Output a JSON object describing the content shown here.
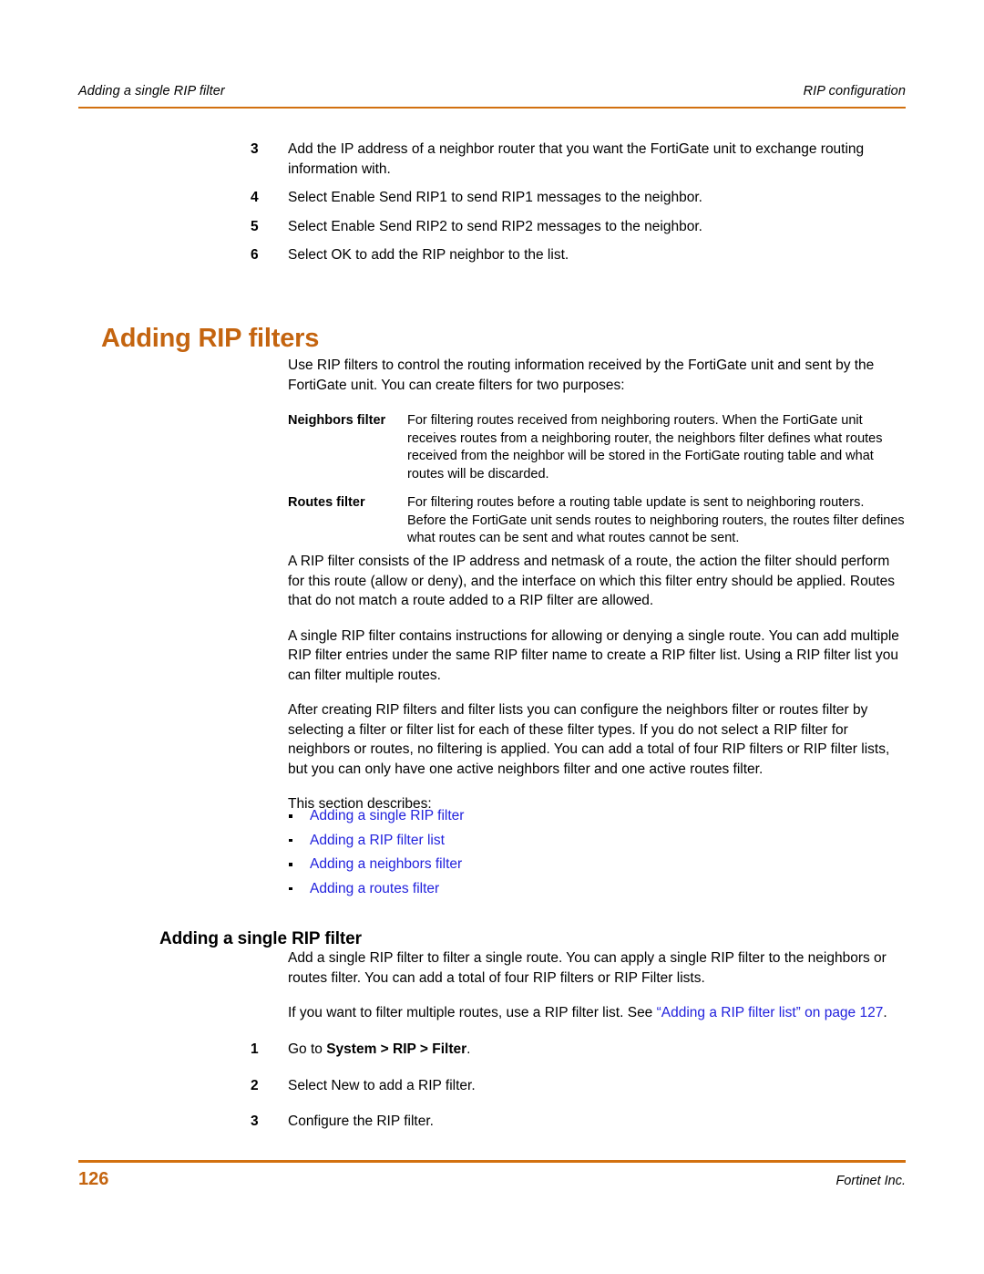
{
  "header": {
    "left_text": "Adding a single RIP filter",
    "right_text": "RIP configuration"
  },
  "top_steps": [
    {
      "number": "3",
      "text": "Add the IP address of a neighbor router that you want the FortiGate unit to exchange routing information with."
    },
    {
      "number": "4",
      "text": "Select Enable Send RIP1 to send RIP1 messages to the neighbor."
    },
    {
      "number": "5",
      "text": "Select Enable Send RIP2 to send RIP2 messages to the neighbor."
    },
    {
      "number": "6",
      "text": "Select OK to add the RIP neighbor to the list."
    }
  ],
  "section": {
    "heading": "Adding RIP filters",
    "intro": "Use RIP filters to control the routing information received by the FortiGate unit and sent by the FortiGate unit. You can create filters for two purposes:",
    "definitions": [
      {
        "term": "Neighbors filter",
        "description": "For filtering routes received from neighboring routers. When the FortiGate unit receives routes from a neighboring router, the neighbors filter defines what routes received from the neighbor will be stored in the FortiGate routing table and what routes will be discarded."
      },
      {
        "term": "Routes filter",
        "description": "For filtering routes before a routing table update is sent to neighboring routers. Before the FortiGate unit sends routes to neighboring routers, the routes filter defines what routes can be sent and what routes cannot be sent."
      }
    ],
    "paragraphs": [
      "A RIP filter consists of the IP address and netmask of a route, the action the filter should perform for this route (allow or deny), and the interface on which this filter entry should be applied. Routes that do not match a route added to a RIP filter are allowed.",
      "A single RIP filter contains instructions for allowing or denying a single route. You can add multiple RIP filter entries under the same RIP filter name to create a RIP filter list. Using a RIP filter list you can filter multiple routes.",
      "After creating RIP filters and filter lists you can configure the neighbors filter or routes filter by selecting a filter or filter list for each of these filter types. If you do not select a RIP filter for neighbors or routes, no filtering is applied. You can add a total of four RIP filters or RIP filter lists, but you can only have one active neighbors filter and one active routes filter.",
      "This section describes:"
    ],
    "link_bullets": [
      "Adding a single RIP filter",
      "Adding a RIP filter list",
      "Adding a neighbors filter",
      "Adding a routes filter"
    ]
  },
  "subsection": {
    "heading": "Adding a single RIP filter",
    "paragraph_1": "Add a single RIP filter to filter a single route. You can apply a single RIP filter to the neighbors or routes filter. You can add a total of four RIP filters or RIP Filter lists.",
    "paragraph_2_prefix": "If you want to filter multiple routes, use a RIP filter list. See ",
    "paragraph_2_link": "“Adding a RIP filter list” on page 127",
    "paragraph_2_suffix": ".",
    "steps": [
      {
        "number": "1",
        "prefix": "Go to ",
        "bold": "System > RIP > Filter",
        "suffix": "."
      },
      {
        "number": "2",
        "prefix": "Select New to add a RIP filter.",
        "bold": "",
        "suffix": ""
      },
      {
        "number": "3",
        "prefix": "Configure the RIP filter.",
        "bold": "",
        "suffix": ""
      }
    ]
  },
  "footer": {
    "page_number": "126",
    "publisher": "Fortinet Inc."
  },
  "colors": {
    "accent_orange": "#C4640F",
    "rule_orange": "#D2700F",
    "link_blue": "#2222DD"
  }
}
